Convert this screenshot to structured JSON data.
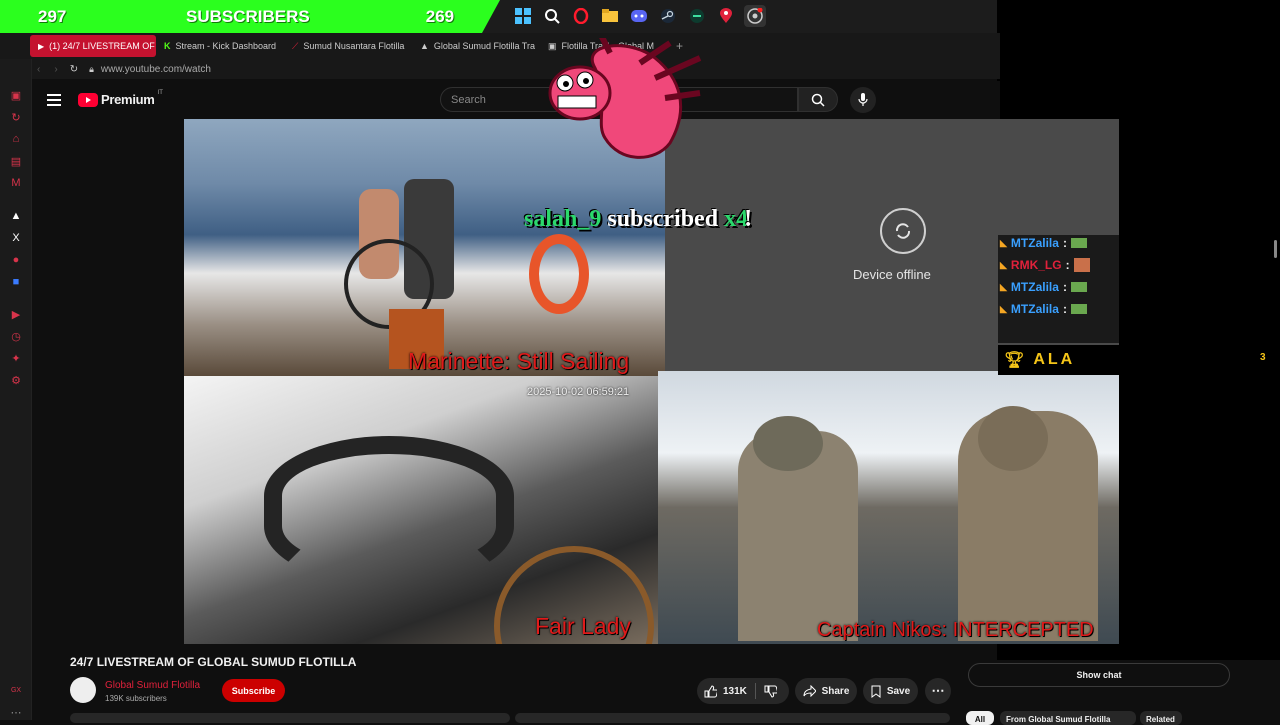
{
  "overlay_bar": {
    "left_count": "297",
    "label": "SUBSCRIBERS",
    "right_count": "269"
  },
  "taskbar_icons": [
    "windows-icon",
    "search-icon",
    "opera-icon",
    "folder-icon",
    "discord-icon",
    "steam-icon",
    "app-icon",
    "maps-icon",
    "obs-icon"
  ],
  "tabs": [
    {
      "label": "(1) 24/7 LIVESTREAM OF",
      "active": true
    },
    {
      "label": "Stream - Kick Dashboard",
      "active": false
    },
    {
      "label": "Sumud Nusantara Flotilla",
      "active": false
    },
    {
      "label": "Global Sumud Flotilla Tra",
      "active": false
    },
    {
      "label": "Flotilla Tracker",
      "active": false
    },
    {
      "label": "Global M",
      "active": false
    }
  ],
  "url": "www.youtube.com/watch",
  "youtube": {
    "brand": "Premium",
    "region": "IT",
    "search_placeholder": "Search"
  },
  "sub_alert": {
    "user": "salah_9",
    "text": "subscribed",
    "multiplier": "x4",
    "bang": "!"
  },
  "offline": {
    "text": "Device offline"
  },
  "cams": {
    "cam1": "Marinette: Still Sailing",
    "cam2": "Fair Lady",
    "cam2_time": "2025-10-02 06:59:21",
    "cam3": "Captain Nikos: INTERCEPTED"
  },
  "chat_lines": [
    {
      "user": "MTZalila",
      "color": "#3aa0ff"
    },
    {
      "user": "RMK_LG",
      "color": "#e0213b"
    },
    {
      "user": "MTZalila",
      "color": "#3aa0ff"
    },
    {
      "user": "MTZalila",
      "color": "#3aa0ff"
    }
  ],
  "leader": {
    "name": "ALA",
    "count": "3"
  },
  "video": {
    "title": "24/7 LIVESTREAM OF GLOBAL SUMUD FLOTILLA",
    "channel": "Global Sumud Flotilla",
    "subs": "139K subscribers",
    "subscribe": "Subscribe",
    "likes": "131K",
    "share": "Share",
    "save": "Save",
    "show_chat": "Show chat"
  },
  "chips": {
    "all": "All",
    "from": "From Global Sumud Flotilla",
    "related": "Related"
  },
  "colors": {
    "accent_green": "#2bff1e",
    "yt_red": "#ff0033",
    "caption_red": "#e01a1a"
  }
}
